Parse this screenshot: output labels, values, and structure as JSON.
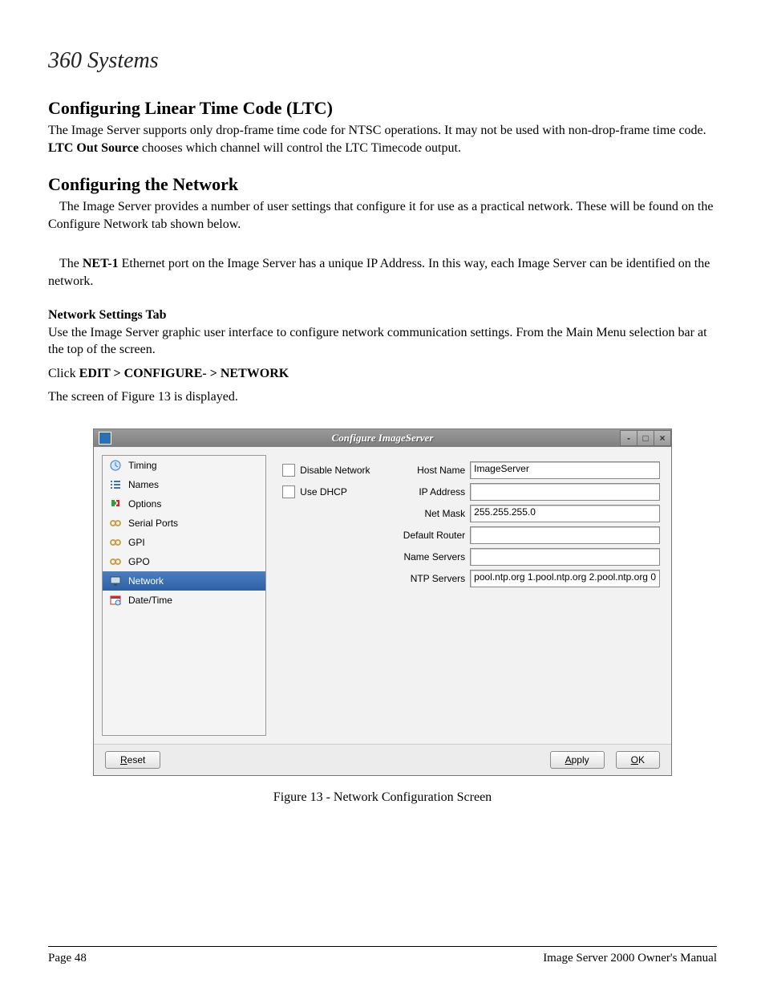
{
  "logo_text": "360 Systems",
  "section_ltc": {
    "heading": "Configuring Linear Time Code (LTC)",
    "para_a": "The Image Server supports only drop-frame time code for NTSC operations. It may not be used with non-drop-frame time code. ",
    "para_bold": "LTC Out Source",
    "para_b": " chooses which channel will control the LTC Timecode output."
  },
  "section_net": {
    "heading": "Configuring the Network",
    "p1": "The Image Server provides a number of user settings that configure it for use as a practical network. These will be found on the Configure Network tab shown below.",
    "p2a": "The ",
    "p2bold": "NET-1",
    "p2b": " Ethernet port on the Image Server has a unique IP Address.  In this way, each Image Server can be identified on the network.",
    "sub": "Network Settings Tab",
    "p3": "Use the Image Server graphic user interface to configure network communication settings. From the Main Menu selection bar at the top of the screen.",
    "p4a": "Click ",
    "p4bold": "EDIT > CONFIGURE- > NETWORK",
    "p5": "The screen of Figure 13 is displayed."
  },
  "figure_caption": "Figure 13 - Network Configuration Screen",
  "footer": {
    "left": "Page 48",
    "right": "Image Server 2000 Owner's Manual"
  },
  "window": {
    "title": "Configure ImageServer",
    "sidebar": [
      {
        "label": "Timing",
        "icon": "clock"
      },
      {
        "label": "Names",
        "icon": "list"
      },
      {
        "label": "Options",
        "icon": "puzzle"
      },
      {
        "label": "Serial Ports",
        "icon": "chain"
      },
      {
        "label": "GPI",
        "icon": "chain"
      },
      {
        "label": "GPO",
        "icon": "chain"
      },
      {
        "label": "Network",
        "icon": "monitor",
        "selected": true
      },
      {
        "label": "Date/Time",
        "icon": "cal"
      }
    ],
    "checkboxes": {
      "disable_label": "Disable Network",
      "dhcp_label": "Use DHCP"
    },
    "labels": {
      "host": "Host Name",
      "ip": "IP Address",
      "mask": "Net Mask",
      "router": "Default Router",
      "dns": "Name Servers",
      "ntp": "NTP Servers"
    },
    "values": {
      "host": "ImageServer",
      "ip": "",
      "mask": "255.255.255.0",
      "router": "",
      "dns": "",
      "ntp": "pool.ntp.org  1.pool.ntp.org  2.pool.ntp.org  0"
    },
    "buttons": {
      "reset": "Reset",
      "apply": "Apply",
      "ok": "OK"
    }
  }
}
